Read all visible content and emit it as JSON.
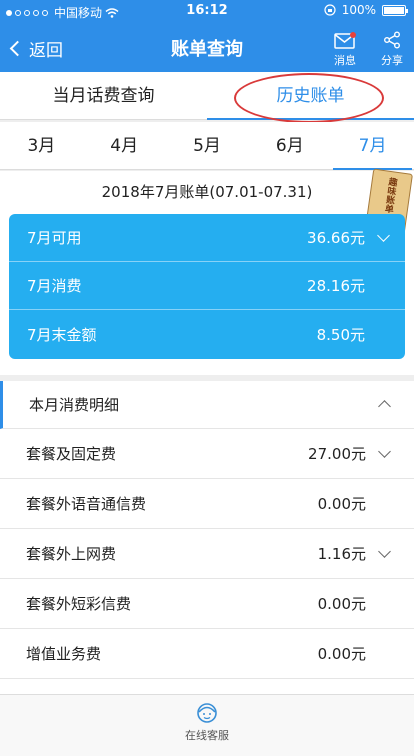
{
  "status": {
    "carrier": "中国移动",
    "time": "16:12",
    "battery": "100%"
  },
  "nav": {
    "back_label": "返回",
    "title": "账单查询",
    "message_label": "消息",
    "share_label": "分享"
  },
  "main_tabs": [
    {
      "label": "当月话费查询"
    },
    {
      "label": "历史账单"
    }
  ],
  "months": [
    {
      "label": "3月"
    },
    {
      "label": "4月"
    },
    {
      "label": "5月"
    },
    {
      "label": "6月"
    },
    {
      "label": "7月"
    }
  ],
  "bill": {
    "period": "2018年7月账单(07.01-07.31)",
    "sticker_text": "趣味账单",
    "rows": [
      {
        "label": "7月可用",
        "value": "36.66元"
      },
      {
        "label": "7月消费",
        "value": "28.16元"
      },
      {
        "label": "7月末金额",
        "value": "8.50元"
      }
    ]
  },
  "details": {
    "title": "本月消费明细",
    "rows": [
      {
        "label": "套餐及固定费",
        "value": "27.00元"
      },
      {
        "label": "套餐外语音通信费",
        "value": "0.00元"
      },
      {
        "label": "套餐外上网费",
        "value": "1.16元"
      },
      {
        "label": "套餐外短彩信费",
        "value": "0.00元"
      },
      {
        "label": "增值业务费",
        "value": "0.00元"
      }
    ]
  },
  "bottom": {
    "service_label": "在线客服"
  },
  "colors": {
    "brand": "#2e8ee8",
    "card": "#25aef0",
    "annotation": "#d93a3a"
  }
}
